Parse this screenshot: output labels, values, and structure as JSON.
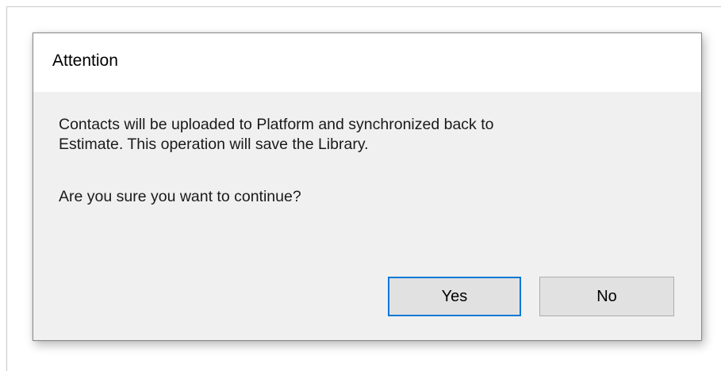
{
  "dialog": {
    "title": "Attention",
    "message_line1": "Contacts will be uploaded to Platform and synchronized back to",
    "message_line2": "Estimate. This operation will save the Library.",
    "question": "Are you sure you want to continue?",
    "buttons": {
      "yes_label": "Yes",
      "no_label": "No"
    }
  },
  "colors": {
    "titlebar_bg": "#ffffff",
    "client_bg": "#f0f0f0",
    "default_button_border": "#0078d7",
    "button_bg": "#e1e1e1"
  }
}
